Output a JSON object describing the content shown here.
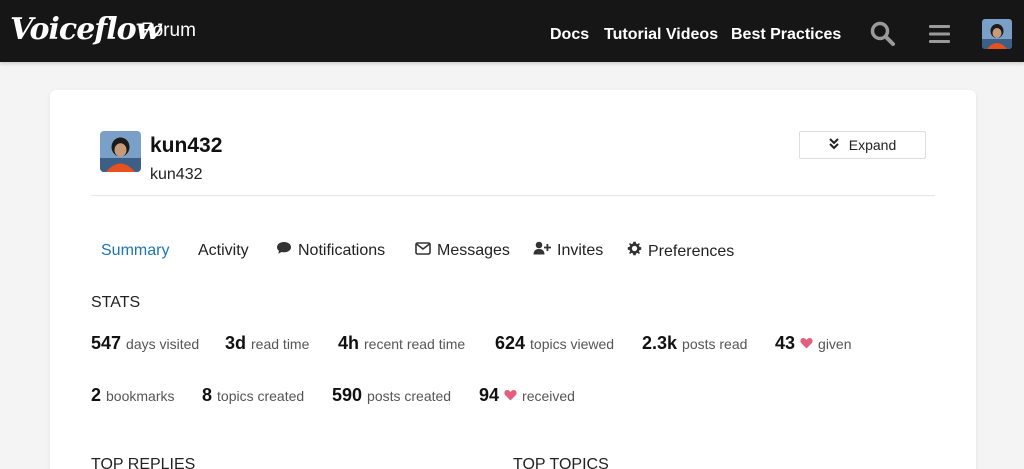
{
  "header": {
    "logo": "Voiceflow",
    "logo_sub": "Forum",
    "nav": [
      "Docs",
      "Tutorial Videos",
      "Best Practices"
    ]
  },
  "profile": {
    "username": "kun432",
    "name": "kun432",
    "expand_label": "Expand"
  },
  "tabs": [
    {
      "label": "Summary",
      "icon": "",
      "active": true
    },
    {
      "label": "Activity",
      "icon": ""
    },
    {
      "label": "Notifications",
      "icon": "comment-icon"
    },
    {
      "label": "Messages",
      "icon": "envelope-icon"
    },
    {
      "label": "Invites",
      "icon": "user-plus-icon"
    },
    {
      "label": "Preferences",
      "icon": "gear-icon"
    }
  ],
  "stats": {
    "title": "STATS",
    "row1": [
      {
        "num": "547",
        "label": "days visited"
      },
      {
        "num": "3d",
        "label": "read time"
      },
      {
        "num": "4h",
        "label": "recent read time"
      },
      {
        "num": "624",
        "label": "topics viewed"
      },
      {
        "num": "2.3k",
        "label": "posts read"
      },
      {
        "num": "43",
        "label": "given",
        "heart": true
      }
    ],
    "row2": [
      {
        "num": "2",
        "label": "bookmarks"
      },
      {
        "num": "8",
        "label": "topics created"
      },
      {
        "num": "590",
        "label": "posts created"
      },
      {
        "num": "94",
        "label": "received",
        "heart": true
      }
    ]
  },
  "sections": {
    "top_replies": "TOP REPLIES",
    "top_topics": "TOP TOPICS"
  },
  "colors": {
    "accent": "#1e74b6",
    "heart": "#e45f7f",
    "header_bg": "#161616"
  }
}
